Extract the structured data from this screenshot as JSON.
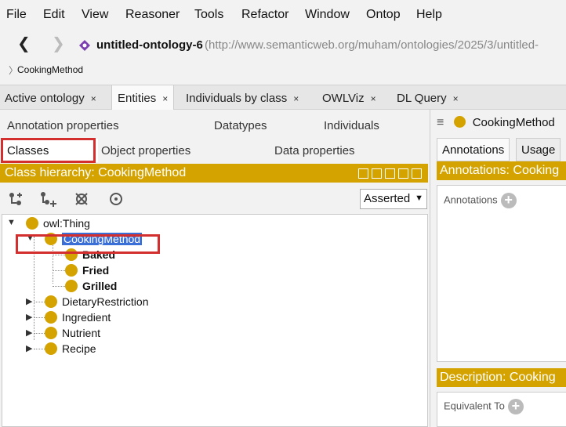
{
  "menu": [
    "File",
    "Edit",
    "View",
    "Reasoner",
    "Tools",
    "Refactor",
    "Window",
    "Ontop",
    "Help"
  ],
  "address": {
    "ontology_name": "untitled-ontology-6",
    "ontology_url": "(http://www.semanticweb.org/muham/ontologies/2025/3/untitled-"
  },
  "breadcrumb": "CookingMethod",
  "workspace_tabs": [
    {
      "label": "Active ontology",
      "close": "×"
    },
    {
      "label": "Entities",
      "close": "×"
    },
    {
      "label": "Individuals by class",
      "close": "×"
    },
    {
      "label": "OWLViz",
      "close": "×"
    },
    {
      "label": "DL Query",
      "close": "×"
    }
  ],
  "left": {
    "subtabs_row1": [
      "Annotation properties",
      "Datatypes",
      "Individuals"
    ],
    "subtabs_row2": [
      "Classes",
      "Object properties",
      "Data properties"
    ],
    "hierarchy_title": "Class hierarchy: CookingMethod",
    "asserted": "Asserted",
    "tree": {
      "root": "owl:Thing",
      "selected": "CookingMethod",
      "children_of_selected": [
        "Baked",
        "Fried",
        "Grilled"
      ],
      "siblings": [
        "DietaryRestriction",
        "Ingredient",
        "Nutrient",
        "Recipe"
      ]
    }
  },
  "right": {
    "title": "CookingMethod",
    "tabs": [
      "Annotations",
      "Usage"
    ],
    "annotations_bar": "Annotations: Cooking",
    "annotations_label": "Annotations",
    "description_bar": "Description: Cooking",
    "equivalent_label": "Equivalent To"
  },
  "colors": {
    "accent": "#d4a300",
    "selection": "#3a6fd8",
    "highlight": "#d32f2f"
  }
}
